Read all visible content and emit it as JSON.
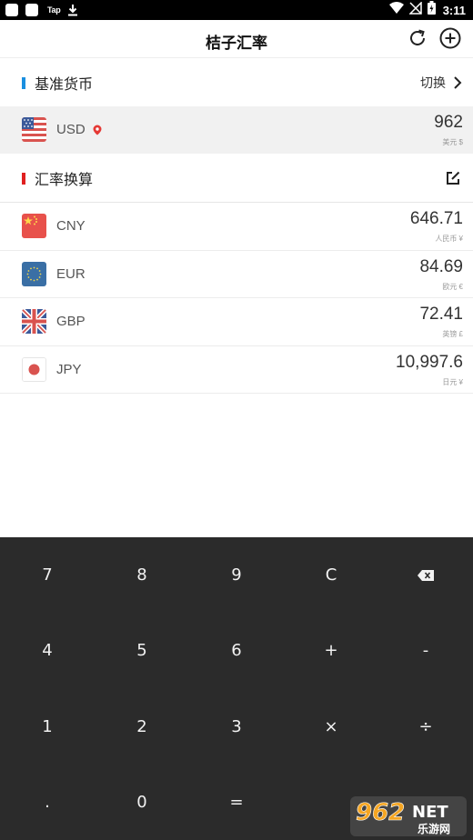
{
  "status_bar": {
    "tap_label": "Tap",
    "time": "3:11",
    "icons": [
      "app-square-icon",
      "app-square-icon",
      "download-icon",
      "wifi-icon",
      "no-signal-icon",
      "battery-icon"
    ]
  },
  "app_bar": {
    "title": "桔子汇率",
    "refresh_icon": "refresh-icon",
    "add_icon": "add-circle-icon"
  },
  "base_section": {
    "title": "基准货币",
    "accent": "#1a8fe0",
    "switch_label": "切换"
  },
  "base_currency": {
    "code": "USD",
    "amount": "962",
    "unit": "美元 $",
    "flag": "us-flag-icon",
    "location_icon": "location-pin-icon"
  },
  "rates_section": {
    "title": "汇率换算",
    "accent": "#e02020",
    "edit_icon": "edit-icon"
  },
  "rates": [
    {
      "code": "CNY",
      "amount": "646.71",
      "unit": "人民币 ¥",
      "flag": "cn-flag-icon"
    },
    {
      "code": "EUR",
      "amount": "84.69",
      "unit": "欧元 €",
      "flag": "eu-flag-icon"
    },
    {
      "code": "GBP",
      "amount": "72.41",
      "unit": "英镑 £",
      "flag": "gb-flag-icon"
    },
    {
      "code": "JPY",
      "amount": "10,997.6",
      "unit": "日元 ¥",
      "flag": "jp-flag-icon"
    }
  ],
  "keypad": {
    "keys": [
      "7",
      "8",
      "9",
      "C",
      "⌫",
      "4",
      "5",
      "6",
      "+",
      "-",
      "1",
      "2",
      "3",
      "×",
      "÷",
      ".",
      "0",
      "=",
      "",
      ""
    ],
    "background": "#2b2b2b"
  },
  "watermark": {
    "brand": "962",
    "net": "NET",
    "subtitle": "乐游网"
  }
}
